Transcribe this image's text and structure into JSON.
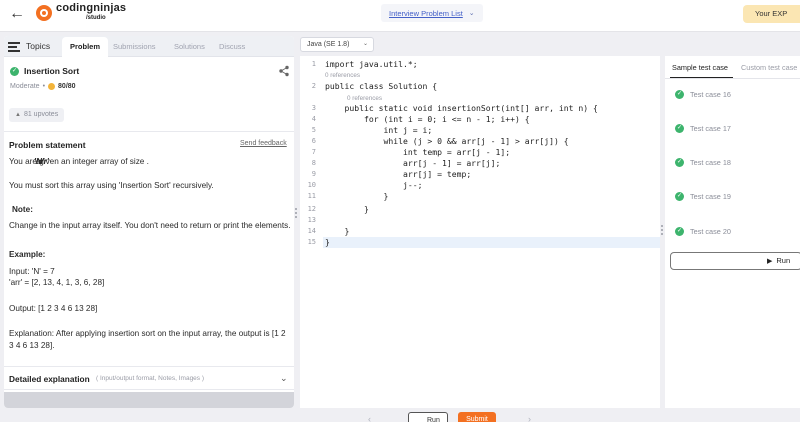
{
  "header": {
    "logo_name": "codingninjas",
    "logo_sub": "/studio",
    "problem_list": "Interview Problem List",
    "exp_badge": "Your EXP"
  },
  "left_tabs": {
    "topics": "Topics",
    "problem": "Problem",
    "submissions": "Submissions",
    "solutions": "Solutions",
    "discuss": "Discuss"
  },
  "problem": {
    "title": "Insertion Sort",
    "difficulty": "Moderate",
    "score": "80/80",
    "upvotes": "81 upvotes",
    "statement_heading": "Problem statement",
    "send_feedback": "Send feedback",
    "line1_a": "You are given an integer array ",
    "line1_b": "'arr'",
    "line1_c": " of size ",
    "line1_d": "'N'",
    "line1_e": ".",
    "line2": "You must sort this array using 'Insertion Sort' recursively.",
    "note_heading": "Note:",
    "note_text": "Change in the input array itself. You don't need to return or print the elements.",
    "example_heading": "Example:",
    "input_1": "Input: 'N' = 7",
    "input_2": "'arr' = [2, 13, 4, 1, 3, 6, 28]",
    "output": "Output: [1 2 3 4 6 13 28]",
    "explanation": "Explanation: After applying insertion sort on the input array, the output is [1 2 3 4 6 13 28].",
    "detailed_label": "Detailed explanation",
    "detailed_sub": "( Input/output format, Notes, Images )"
  },
  "editor": {
    "language": "Java (SE 1.8)",
    "reference_hint": "0 references",
    "lines": [
      {
        "n": "1",
        "text": "import java.util.*;"
      },
      {
        "n": "2",
        "text": "public class Solution {"
      },
      {
        "n": "3",
        "text": "    public static void insertionSort(int[] arr, int n) {"
      },
      {
        "n": "4",
        "text": "        for (int i = 0; i <= n - 1; i++) {"
      },
      {
        "n": "5",
        "text": "            int j = i;"
      },
      {
        "n": "6",
        "text": "            while (j > 0 && arr[j - 1] > arr[j]) {"
      },
      {
        "n": "7",
        "text": "                int temp = arr[j - 1];"
      },
      {
        "n": "8",
        "text": "                arr[j - 1] = arr[j];"
      },
      {
        "n": "9",
        "text": "                arr[j] = temp;"
      },
      {
        "n": "10",
        "text": "                j--;"
      },
      {
        "n": "11",
        "text": "            }"
      },
      {
        "n": "12",
        "text": "        }"
      },
      {
        "n": "13",
        "text": ""
      },
      {
        "n": "14",
        "text": "    }"
      },
      {
        "n": "15",
        "text": "}"
      }
    ],
    "run_label": "Run",
    "submit_label": "Submit"
  },
  "right": {
    "tab_sample": "Sample test case",
    "tab_custom": "Custom test case",
    "test_cases": [
      "Test case 16",
      "Test case 17",
      "Test case 18",
      "Test case 19",
      "Test case 20"
    ],
    "run_label": "Run"
  },
  "colors": {
    "accent_orange": "#f37021",
    "success_green": "#3db46d",
    "link_blue": "#4460c8",
    "exp_badge_bg": "#fbe6b3"
  },
  "icons": {
    "back": "arrow-left-icon",
    "share": "share-icon",
    "check": "check-circle-icon",
    "coin": "coin-icon",
    "upvote": "upvote-icon",
    "play": "play-icon",
    "chevron": "chevron-down-icon"
  }
}
